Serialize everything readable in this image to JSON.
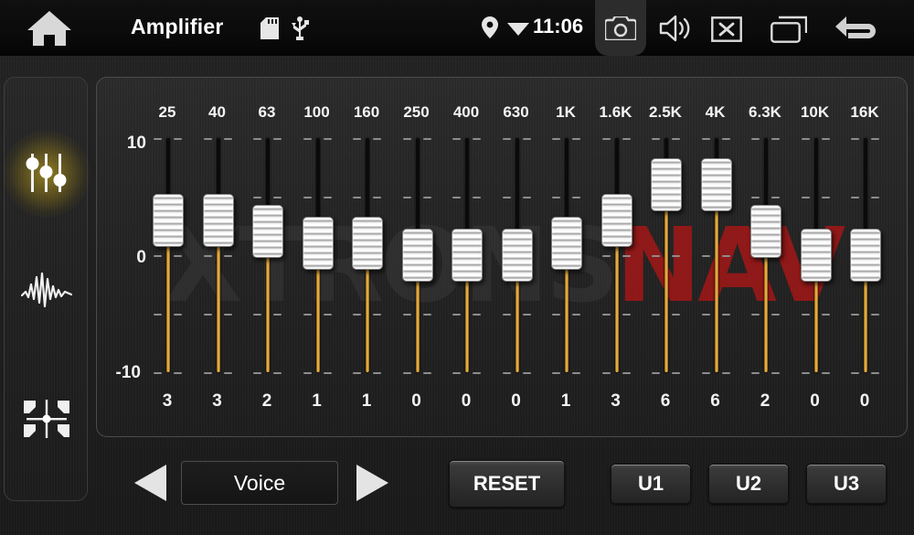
{
  "statusbar": {
    "home_icon": "home-icon",
    "title": "Amplifier",
    "sd_icon": "sd-card-icon",
    "usb_icon": "usb-icon",
    "gps_icon": "location-pin-icon",
    "wifi_icon": "wifi-icon",
    "clock": "11:06",
    "camera_icon": "camera-icon",
    "volume_icon": "speaker-volume-icon",
    "mute_icon": "mute-x-icon",
    "recent_icon": "recent-apps-icon",
    "back_icon": "back-arrow-icon"
  },
  "sidebar": {
    "items": [
      {
        "name": "equalizer",
        "icon": "equalizer-sliders-icon",
        "active": true
      },
      {
        "name": "sound-effect",
        "icon": "waveform-icon",
        "active": false
      },
      {
        "name": "balance-fader",
        "icon": "balance-fader-icon",
        "active": false
      }
    ]
  },
  "watermark": {
    "dark_text": "XTRONS",
    "red_text": "NAV"
  },
  "equalizer": {
    "scale": {
      "max_label": "10",
      "mid_label": "0",
      "min_label": "-10"
    },
    "range": [
      -10,
      10
    ],
    "accent_color": "#e8a93a",
    "bands": [
      {
        "freq": "25",
        "value": "3"
      },
      {
        "freq": "40",
        "value": "3"
      },
      {
        "freq": "63",
        "value": "2"
      },
      {
        "freq": "100",
        "value": "1"
      },
      {
        "freq": "160",
        "value": "1"
      },
      {
        "freq": "250",
        "value": "0"
      },
      {
        "freq": "400",
        "value": "0"
      },
      {
        "freq": "630",
        "value": "0"
      },
      {
        "freq": "1K",
        "value": "1"
      },
      {
        "freq": "1.6K",
        "value": "3"
      },
      {
        "freq": "2.5K",
        "value": "6"
      },
      {
        "freq": "4K",
        "value": "6"
      },
      {
        "freq": "6.3K",
        "value": "2"
      },
      {
        "freq": "10K",
        "value": "0"
      },
      {
        "freq": "16K",
        "value": "0"
      }
    ]
  },
  "controls": {
    "prev_icon": "arrow-left-icon",
    "next_icon": "arrow-right-icon",
    "preset_value": "Voice",
    "reset_label": "RESET",
    "user_presets": [
      "U1",
      "U2",
      "U3"
    ]
  }
}
